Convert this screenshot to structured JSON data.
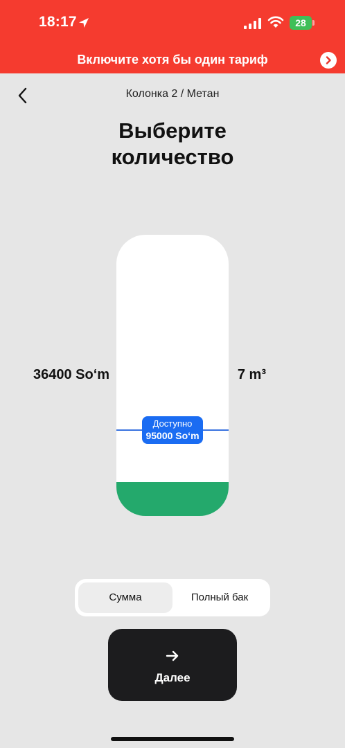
{
  "status_bar": {
    "time": "18:17",
    "battery": "28",
    "icons": [
      "location-arrow-icon",
      "cellular-signal-icon",
      "wifi-icon",
      "battery-charging-icon"
    ]
  },
  "banner": {
    "text": "Включите хотя бы один тариф",
    "icon": "chevron-right-icon"
  },
  "header": {
    "breadcrumb": "Колонка 2 / Метан",
    "title_line1": "Выберите",
    "title_line2": "количество",
    "back_icon": "chevron-left-icon"
  },
  "selector": {
    "amount": "36400 So‘m",
    "volume": "7 m³",
    "limit_label": "Доступно",
    "limit_value": "95000 So‘m",
    "fill_fraction": 0.12,
    "limit_fraction": 0.31
  },
  "mode_switch": {
    "options": [
      "Сумма",
      "Полный бак"
    ],
    "selected": "Сумма"
  },
  "next_button": {
    "label": "Далее",
    "icon": "arrow-right-icon"
  },
  "colors": {
    "banner_red": "#f53b2f",
    "fill_green": "#24a96c",
    "badge_blue": "#1a6cf2",
    "button_dark": "#1c1c1e"
  }
}
